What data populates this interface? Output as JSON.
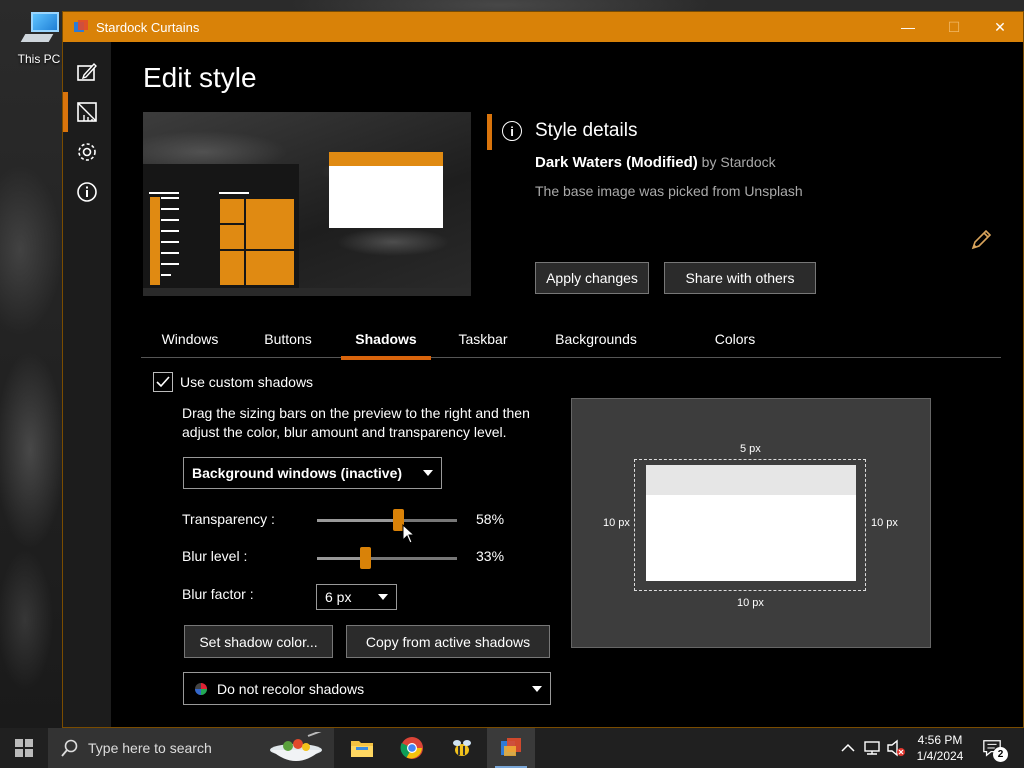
{
  "desktop": {
    "icon_label": "This PC"
  },
  "window": {
    "title": "Stardock Curtains",
    "minimize": "—",
    "maximize": "☐",
    "close": "✕"
  },
  "page": {
    "title": "Edit style"
  },
  "details": {
    "heading": "Style details",
    "style_name": "Dark Waters (Modified)",
    "by_text": " by Stardock",
    "description": "The base image was picked from Unsplash",
    "apply_label": "Apply changes",
    "share_label": "Share with others"
  },
  "tabs": [
    "Windows",
    "Buttons",
    "Shadows",
    "Taskbar",
    "Backgrounds",
    "Colors"
  ],
  "active_tab": "Shadows",
  "shadows": {
    "use_custom_label": "Use custom shadows",
    "use_custom_checked": true,
    "instructions_line1": "Drag the sizing bars on the preview to the right and then",
    "instructions_line2": "adjust the color, blur amount and transparency level.",
    "target_select": "Background windows (inactive)",
    "transparency_label": "Transparency :",
    "transparency_value": "58%",
    "blur_level_label": "Blur level :",
    "blur_level_value": "33%",
    "blur_factor_label": "Blur factor :",
    "blur_factor_value": "6 px",
    "set_color_label": "Set shadow color...",
    "copy_label": "Copy from active shadows",
    "recolor_select": "Do not recolor shadows"
  },
  "shadow_preview": {
    "top": "5 px",
    "left": "10 px",
    "right": "10 px",
    "bottom": "10 px"
  },
  "taskbar": {
    "search_placeholder": "Type here to search",
    "time": "4:56 PM",
    "date": "1/4/2024",
    "notifications": "2"
  },
  "colors": {
    "accent": "#d98208",
    "titlebar": "#d98208",
    "background": "#000000"
  },
  "icons": [
    "edit-style-icon",
    "curtains-style-icon",
    "settings-gear-icon",
    "info-icon",
    "pencil-icon",
    "windows-start-icon",
    "search-icon",
    "file-explorer-icon",
    "chrome-icon",
    "bee-app-icon",
    "curtains-app-icon",
    "chevron-up-icon",
    "network-icon",
    "volume-muted-icon",
    "notification-icon"
  ]
}
